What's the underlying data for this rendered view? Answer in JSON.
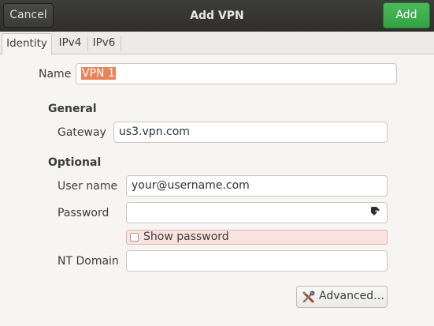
{
  "header": {
    "title": "Add VPN",
    "cancel_label": "Cancel",
    "add_label": "Add",
    "add_color": "#3fae4e"
  },
  "tabs": [
    "Identity",
    "IPv4",
    "IPv6"
  ],
  "form": {
    "name_label": "Name",
    "name_value": "VPN 1",
    "general_heading": "General",
    "gateway_label": "Gateway",
    "gateway_value": "us3.vpn.com",
    "optional_heading": "Optional",
    "username_label": "User name",
    "username_value": "your@username.com",
    "password_label": "Password",
    "password_value": "",
    "show_password_label": "Show password",
    "show_password_checked": false,
    "nt_domain_label": "NT Domain",
    "nt_domain_value": "",
    "advanced_label": "Advanced…"
  },
  "icons": {
    "password_toggle": "password-hint-icon",
    "advanced": "tools-icon"
  },
  "colors": {
    "selection": "#e9835d",
    "header_bg": "#383735",
    "highlight_row": "#f8e3df"
  }
}
